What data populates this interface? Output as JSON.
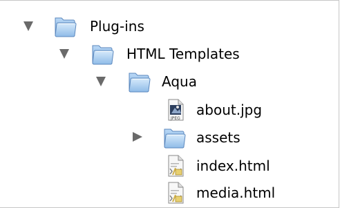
{
  "tree": {
    "items": [
      {
        "label": "Plug-ins",
        "icon": "folder-icon",
        "disclosure": "expanded"
      },
      {
        "label": "HTML Templates",
        "icon": "folder-icon",
        "disclosure": "expanded"
      },
      {
        "label": "Aqua",
        "icon": "folder-icon",
        "disclosure": "expanded"
      },
      {
        "label": "about.jpg",
        "icon": "image-file-icon",
        "disclosure": "none"
      },
      {
        "label": "assets",
        "icon": "folder-icon",
        "disclosure": "collapsed"
      },
      {
        "label": "index.html",
        "icon": "html-file-icon",
        "disclosure": "none"
      },
      {
        "label": "media.html",
        "icon": "html-file-icon",
        "disclosure": "none"
      }
    ]
  },
  "colors": {
    "folder_body": "#9ec6ee",
    "folder_highlight": "#d8ebfb",
    "folder_outline": "#5b87bd",
    "disclosure_triangle": "#6a6a6a",
    "border": "#c6c6c6"
  }
}
